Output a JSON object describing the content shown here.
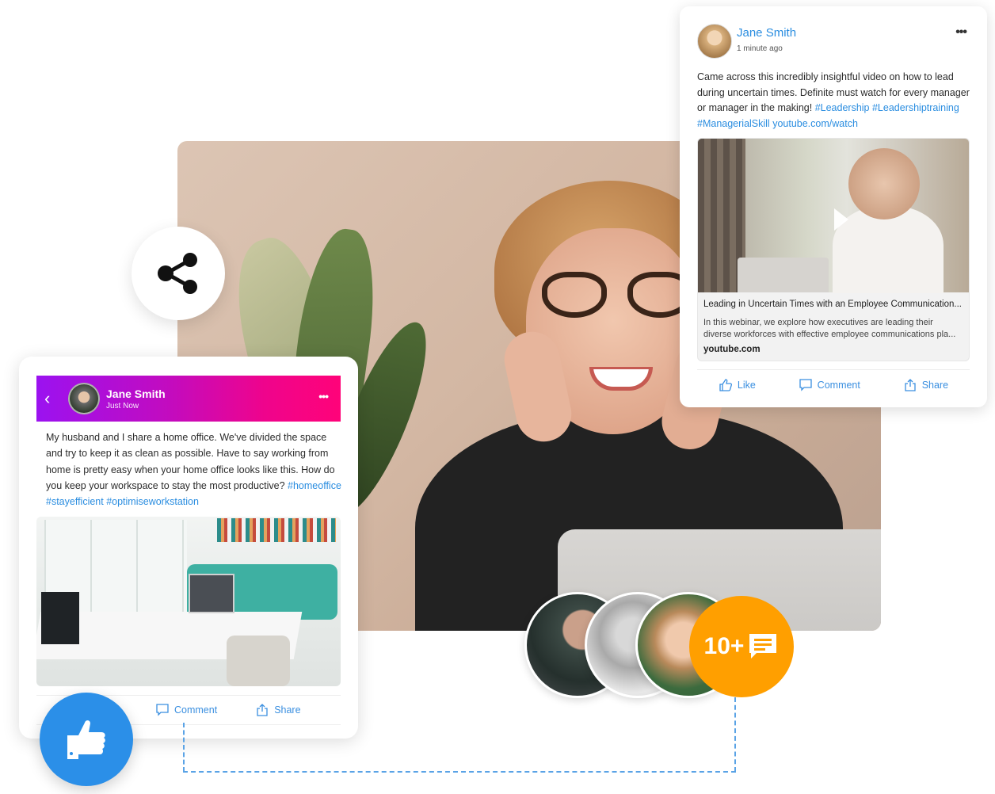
{
  "hero": {
    "alt": "Smiling woman with glasses resting chin on hands"
  },
  "share_bubble": {
    "icon": "share-icon"
  },
  "top_card": {
    "author": "Jane Smith",
    "time": "1 minute ago",
    "more_icon": "•••",
    "text_plain": "Came across this incredibly insightful video on how to lead during uncertain times. Definite must watch for every manager or manager in the making! ",
    "hashtags": "#Leadership #Leadershiptraining #ManagerialSkill",
    "link": "youtube.com/watch",
    "video": {
      "title": "Leading in Uncertain Times with an Employee Communication...",
      "description": "In this webinar, we explore how executives are leading their diverse workforces with effective employee communications pla...",
      "domain": "youtube.com"
    },
    "actions": {
      "like": "Like",
      "comment": "Comment",
      "share": "Share"
    }
  },
  "left_card": {
    "back_icon": "‹",
    "author": "Jane Smith",
    "time": "Just Now",
    "more_icon": "•••",
    "text_plain": "My husband and I share a home office. We've divided the space and try to keep it as clean as possible. Have to say working from home is pretty easy when your home office looks like this. How do you keep your workspace to stay the most productive? ",
    "hashtags": "#homeoffice #stayefficient #optimiseworkstation",
    "actions": {
      "comment": "Comment",
      "share": "Share"
    }
  },
  "like_bubble": {
    "icon": "thumbs-up-icon"
  },
  "comment_count": {
    "label": "10+",
    "icon": "chat-bubble-icon"
  },
  "colors": {
    "link_blue": "#2a8de0",
    "banner_start": "#9b12f0",
    "banner_end": "#ff0379",
    "like_blue": "#2b8fe8",
    "count_orange": "#ff9f00",
    "dash_blue": "#5aa3e6"
  }
}
